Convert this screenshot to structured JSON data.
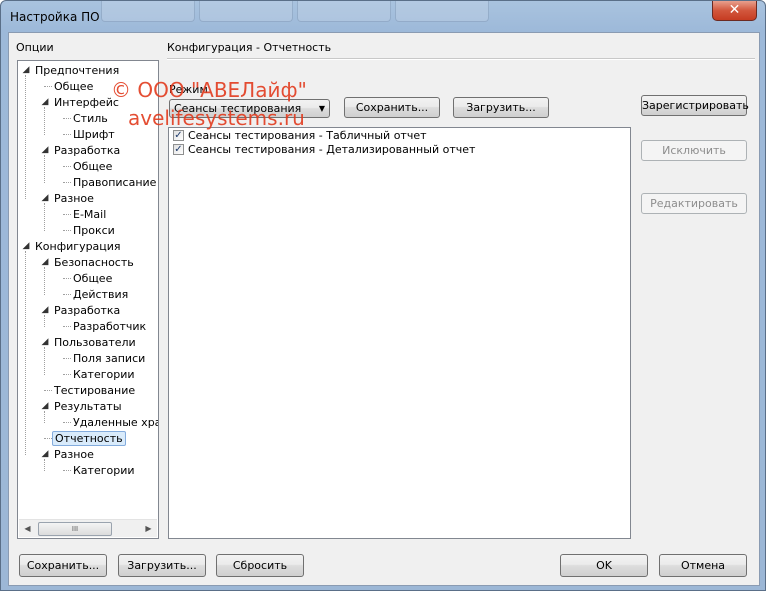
{
  "window": {
    "title": "Настройка ПО",
    "close_glyph": "✕"
  },
  "left": {
    "header": "Опции",
    "tree": [
      {
        "label": "Предпочтения",
        "level": 0,
        "expanded": true
      },
      {
        "label": "Общее",
        "level": 1
      },
      {
        "label": "Интерфейс",
        "level": 1,
        "expanded": true
      },
      {
        "label": "Стиль",
        "level": 2
      },
      {
        "label": "Шрифт",
        "level": 2
      },
      {
        "label": "Разработка",
        "level": 1,
        "expanded": true
      },
      {
        "label": "Общее",
        "level": 2
      },
      {
        "label": "Правописание",
        "level": 2
      },
      {
        "label": "Разное",
        "level": 1,
        "expanded": true
      },
      {
        "label": "E-Mail",
        "level": 2
      },
      {
        "label": "Прокси",
        "level": 2
      },
      {
        "label": "Конфигурация",
        "level": 0,
        "expanded": true
      },
      {
        "label": "Безопасность",
        "level": 1,
        "expanded": true
      },
      {
        "label": "Общее",
        "level": 2
      },
      {
        "label": "Действия",
        "level": 2
      },
      {
        "label": "Разработка",
        "level": 1,
        "expanded": true
      },
      {
        "label": "Разработчик",
        "level": 2
      },
      {
        "label": "Пользователи",
        "level": 1,
        "expanded": true
      },
      {
        "label": "Поля записи",
        "level": 2
      },
      {
        "label": "Категории",
        "level": 2
      },
      {
        "label": "Тестирование",
        "level": 1
      },
      {
        "label": "Результаты",
        "level": 1,
        "expanded": true
      },
      {
        "label": "Удаленные хра",
        "level": 2
      },
      {
        "label": "Отчетность",
        "level": 1,
        "selected": true
      },
      {
        "label": "Разное",
        "level": 1,
        "expanded": true
      },
      {
        "label": "Категории",
        "level": 2
      }
    ],
    "scroll_thumb_glyph": "III"
  },
  "main": {
    "header": "Конфигурация - Отчетность",
    "mode_label": "Режим",
    "mode_value": "Сеансы тестирования",
    "save_button": "Сохранить...",
    "load_button": "Загрузить...",
    "reports": [
      {
        "label": "Сеансы тестирования - Табличный отчет",
        "checked": true
      },
      {
        "label": "Сеансы тестирования - Детализированный отчет",
        "checked": true
      }
    ],
    "register_button": "Зарегистрировать",
    "exclude_button": "Исключить",
    "edit_button": "Редактировать"
  },
  "footer": {
    "save_button": "Сохранить...",
    "load_button": "Загрузить...",
    "reset_button": "Сбросить",
    "ok_button": "OK",
    "cancel_button": "Отмена"
  },
  "watermark": {
    "line1": "© ООО \"АВЕЛайф\"",
    "line2": "avelifesystems.ru"
  },
  "colors": {
    "accent_selection": "#d9ebfb",
    "watermark": "#e23b1e",
    "close_button": "#c63c22"
  }
}
